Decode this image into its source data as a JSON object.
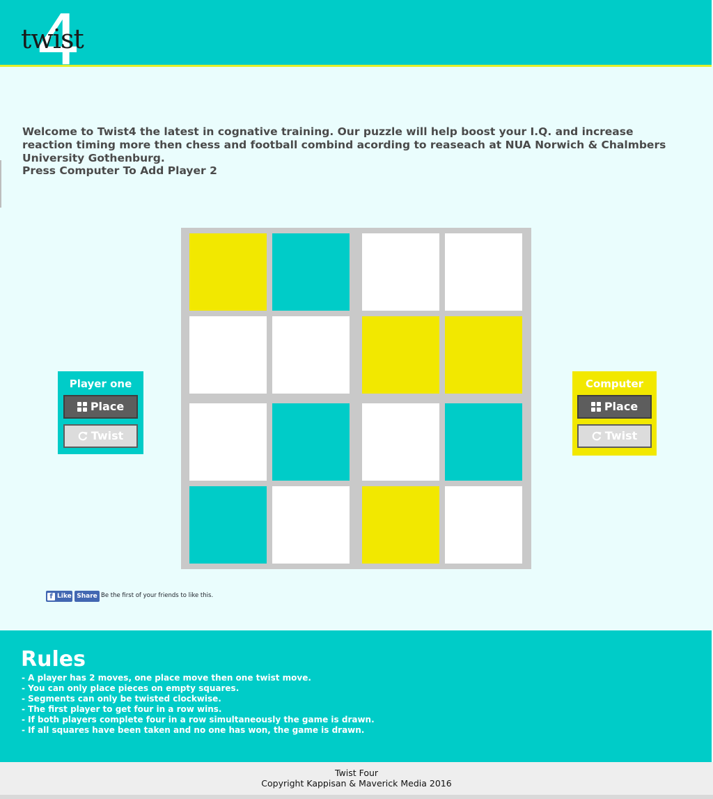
{
  "header": {
    "logo_word": "twist",
    "logo_numeral": "4"
  },
  "intro": {
    "welcome_text": "Welcome to Twist4 the latest in cognative training. Our puzzle will help boost your I.Q. and increase reaction timing more then chess and football combind acording to reaseach at NUA Norwich & Chalmbers University Gothenburg.",
    "prompt": "Press Computer To Add Player 2"
  },
  "colors": {
    "teal": "#00ccc8",
    "yellow": "#f2e800",
    "empty": "#ffffff",
    "board": "#c9c9c9"
  },
  "board": {
    "rows": [
      [
        "yellow",
        "teal",
        "empty",
        "empty"
      ],
      [
        "empty",
        "empty",
        "yellow",
        "yellow"
      ],
      [
        "empty",
        "teal",
        "empty",
        "teal"
      ],
      [
        "teal",
        "empty",
        "yellow",
        "empty"
      ]
    ]
  },
  "player_one": {
    "title": "Player one",
    "place_label": "Place",
    "twist_label": "Twist",
    "place_icon": "grid-icon",
    "twist_icon": "rotate-clockwise-icon"
  },
  "player_two": {
    "title": "Computer",
    "place_label": "Place",
    "twist_label": "Twist",
    "place_icon": "grid-icon",
    "twist_icon": "rotate-clockwise-icon"
  },
  "facebook": {
    "like_label": "Like",
    "share_label": "Share",
    "social_text": "Be the first of your friends to like this."
  },
  "rules": {
    "title": "Rules",
    "items": [
      "- A player has 2 moves, one place move then one twist move.",
      "- You can only place pieces on empty squares.",
      "- Segments can only be twisted clockwise.",
      "- The first player to get four in a row wins.",
      "- If both players complete four in a row simultaneously the game is drawn.",
      "- If all squares have been taken and no one has won, the game is drawn."
    ]
  },
  "footer": {
    "line1": "Twist Four",
    "line2": "Copyright Kappisan & Maverick Media 2016"
  }
}
